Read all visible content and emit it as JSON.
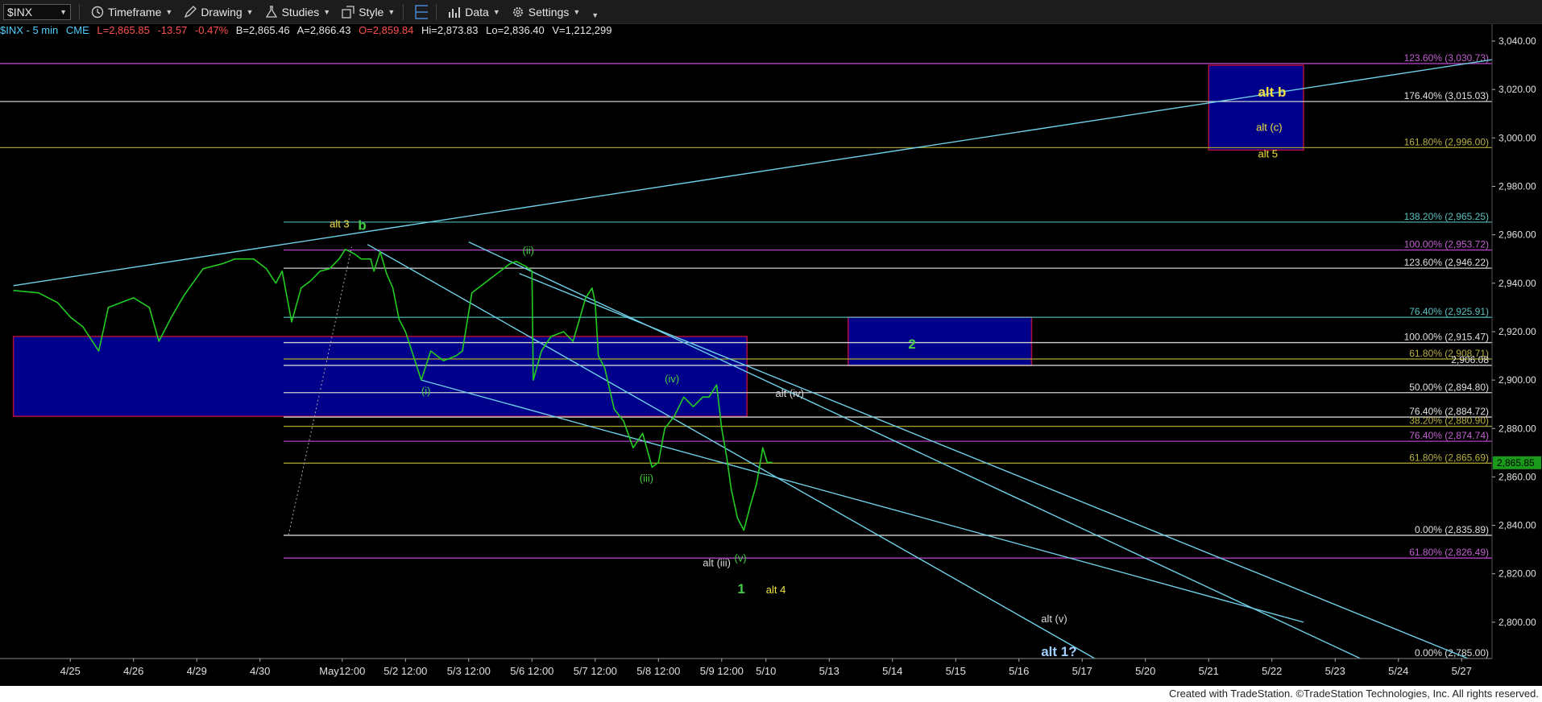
{
  "toolbar": {
    "symbol": "$INX",
    "timeframe": "Timeframe",
    "drawing": "Drawing",
    "studies": "Studies",
    "style": "Style",
    "data": "Data",
    "settings": "Settings"
  },
  "quote": {
    "name": "$INX - 5 min",
    "exchange": "CME",
    "last": "L=2,865.85",
    "change": "-13.57",
    "pct": "-0.47%",
    "bid": "B=2,865.46",
    "ask": "A=2,866.43",
    "open": "O=2,859.84",
    "high": "Hi=2,873.83",
    "low": "Lo=2,836.40",
    "volume": "V=1,212,299"
  },
  "colors": {
    "price": "#22cc22",
    "cyan": "#6fd0e8",
    "box_fill": "#00008b",
    "box_border": "#b0103a",
    "fib_purple": "#b040c0",
    "fib_teal": "#4aa6a6",
    "fib_olive": "#a09a30",
    "fib_white": "#cfcfcf"
  },
  "chart_data": {
    "type": "line",
    "symbol": "$INX",
    "interval": "5 min",
    "ylim": [
      2785,
      3045
    ],
    "yticks": [
      "3,040.00",
      "3,020.00",
      "3,000.00",
      "2,980.00",
      "2,960.00",
      "2,940.00",
      "2,920.00",
      "2,900.00",
      "2,880.00",
      "2,860.00",
      "2,840.00",
      "2,820.00",
      "2,800.00"
    ],
    "ytick_values": [
      3040,
      3020,
      3000,
      2980,
      2960,
      2940,
      2920,
      2900,
      2880,
      2860,
      2840,
      2820,
      2800
    ],
    "xticks": [
      "4/25",
      "4/26",
      "4/29",
      "4/30",
      "May12:00",
      "5/2 12:00",
      "5/3 12:00",
      "5/6 12:00",
      "5/7 12:00",
      "5/8 12:00",
      "5/9 12:00",
      "5/10",
      "5/13",
      "5/14",
      "5/15",
      "5/16",
      "5/17",
      "5/20",
      "5/21",
      "5/22",
      "5/23",
      "5/24",
      "5/27"
    ],
    "xtick_index": [
      0.5,
      1.5,
      2.5,
      3.5,
      4.8,
      5.8,
      6.8,
      7.8,
      8.8,
      9.8,
      10.8,
      11.5,
      12.5,
      13.5,
      14.5,
      15.5,
      16.5,
      17.5,
      18.5,
      19.5,
      20.5,
      21.5,
      22.5
    ],
    "last_price": "2,865.85",
    "last_value": 2865.85,
    "price_path": [
      [
        -0.4,
        2937
      ],
      [
        0,
        2936
      ],
      [
        0.3,
        2932
      ],
      [
        0.5,
        2926
      ],
      [
        0.7,
        2922
      ],
      [
        0.95,
        2912
      ],
      [
        1.1,
        2930
      ],
      [
        1.3,
        2932
      ],
      [
        1.5,
        2934
      ],
      [
        1.75,
        2930
      ],
      [
        1.9,
        2916
      ],
      [
        2.1,
        2926
      ],
      [
        2.3,
        2935
      ],
      [
        2.6,
        2946
      ],
      [
        2.9,
        2948
      ],
      [
        3.1,
        2950
      ],
      [
        3.4,
        2950
      ],
      [
        3.6,
        2946
      ],
      [
        3.75,
        2940
      ],
      [
        3.85,
        2945
      ],
      [
        4.0,
        2924
      ],
      [
        4.15,
        2938
      ],
      [
        4.3,
        2941
      ],
      [
        4.45,
        2945
      ],
      [
        4.6,
        2946
      ],
      [
        4.75,
        2950
      ],
      [
        4.85,
        2954
      ],
      [
        5.0,
        2952
      ],
      [
        5.1,
        2950
      ],
      [
        5.25,
        2950
      ],
      [
        5.3,
        2945
      ],
      [
        5.4,
        2953
      ],
      [
        5.5,
        2944
      ],
      [
        5.6,
        2938
      ],
      [
        5.7,
        2925
      ],
      [
        5.8,
        2920
      ],
      [
        5.95,
        2908
      ],
      [
        6.05,
        2900
      ],
      [
        6.2,
        2912
      ],
      [
        6.4,
        2908
      ],
      [
        6.6,
        2910
      ],
      [
        6.7,
        2912
      ],
      [
        6.85,
        2936
      ],
      [
        7.05,
        2940
      ],
      [
        7.3,
        2945
      ],
      [
        7.45,
        2948
      ],
      [
        7.55,
        2949
      ],
      [
        7.7,
        2947
      ],
      [
        7.8,
        2945
      ],
      [
        7.82,
        2900
      ],
      [
        7.95,
        2912
      ],
      [
        8.1,
        2918
      ],
      [
        8.3,
        2920
      ],
      [
        8.45,
        2916
      ],
      [
        8.55,
        2925
      ],
      [
        8.65,
        2934
      ],
      [
        8.75,
        2938
      ],
      [
        8.8,
        2932
      ],
      [
        8.85,
        2910
      ],
      [
        8.95,
        2905
      ],
      [
        9.1,
        2888
      ],
      [
        9.25,
        2883
      ],
      [
        9.4,
        2872
      ],
      [
        9.55,
        2878
      ],
      [
        9.7,
        2864
      ],
      [
        9.8,
        2866
      ],
      [
        9.9,
        2880
      ],
      [
        10.05,
        2885
      ],
      [
        10.2,
        2893
      ],
      [
        10.35,
        2889
      ],
      [
        10.5,
        2893
      ],
      [
        10.6,
        2893
      ],
      [
        10.72,
        2898
      ],
      [
        10.8,
        2880
      ],
      [
        10.88,
        2868
      ],
      [
        10.95,
        2855
      ],
      [
        11.05,
        2843
      ],
      [
        11.15,
        2838
      ],
      [
        11.25,
        2848
      ],
      [
        11.35,
        2857
      ],
      [
        11.45,
        2872
      ],
      [
        11.52,
        2866
      ],
      [
        11.6,
        2866
      ]
    ],
    "fib_levels": [
      {
        "label": "123.60% (3,030.73)",
        "value": 3030.73,
        "color": "purple"
      },
      {
        "label": "176.40% (3,015.03)",
        "value": 3015.03,
        "color": "white"
      },
      {
        "label": "161.80% (2,996.00)",
        "value": 2996.0,
        "color": "olive"
      },
      {
        "label": "138.20% (2,965.25)",
        "value": 2965.25,
        "color": "teal"
      },
      {
        "label": "100.00% (2,953.72)",
        "value": 2953.72,
        "color": "purple"
      },
      {
        "label": "123.60% (2,946.22)",
        "value": 2946.22,
        "color": "white"
      },
      {
        "label": "76.40% (2,925.91)",
        "value": 2925.91,
        "color": "teal"
      },
      {
        "label": "100.00% (2,915.47)",
        "value": 2915.47,
        "color": "white"
      },
      {
        "label": "61.80% (2,908.71)",
        "value": 2908.71,
        "color": "olive"
      },
      {
        "label": "2,906.08",
        "value": 2906.08,
        "color": "white"
      },
      {
        "label": "50.00% (2,894.80)",
        "value": 2894.8,
        "color": "white"
      },
      {
        "label": "76.40% (2,884.72)",
        "value": 2884.72,
        "color": "white"
      },
      {
        "label": "38.20% (2,880.90)",
        "value": 2880.9,
        "color": "olive"
      },
      {
        "label": "76.40% (2,874.74)",
        "value": 2874.74,
        "color": "purple"
      },
      {
        "label": "61.80% (2,865.69)",
        "value": 2865.69,
        "color": "olive"
      },
      {
        "label": "0.00% (2,835.89)",
        "value": 2835.89,
        "color": "white"
      },
      {
        "label": "61.80% (2,826.49)",
        "value": 2826.49,
        "color": "purple"
      },
      {
        "label": "0.00% (2,785.00)",
        "value": 2785.0,
        "color": "white"
      }
    ],
    "boxes": [
      {
        "name": "support-box",
        "x0": -0.4,
        "x1": 11.2,
        "y0": 2885,
        "y1": 2918,
        "label": ""
      },
      {
        "name": "wave-2-box",
        "x0": 12.8,
        "x1": 15.7,
        "y0": 2906,
        "y1": 2926,
        "label": "2"
      },
      {
        "name": "alt-b-box",
        "x0": 18.5,
        "x1": 20.0,
        "y0": 2995,
        "y1": 3030,
        "label": ""
      }
    ],
    "trendlines": [
      {
        "from": [
          -0.4,
          2939
        ],
        "to": [
          23.4,
          3034
        ]
      },
      {
        "from": [
          5.2,
          2956
        ],
        "to": [
          16.7,
          2785
        ]
      },
      {
        "from": [
          6.8,
          2957
        ],
        "to": [
          20.9,
          2785
        ]
      },
      {
        "from": [
          7.6,
          2944
        ],
        "to": [
          22.6,
          2785
        ]
      },
      {
        "from": [
          6.05,
          2900
        ],
        "to": [
          20.0,
          2800
        ]
      }
    ],
    "annotations": [
      {
        "text": "alt 3",
        "x": 4.6,
        "y": 2963,
        "color": "yellow"
      },
      {
        "text": "b",
        "x": 5.05,
        "y": 2962,
        "color": "green"
      },
      {
        "text": "(ii)",
        "x": 7.65,
        "y": 2952,
        "color": "green"
      },
      {
        "text": "(i)",
        "x": 6.05,
        "y": 2894,
        "color": "green"
      },
      {
        "text": "(iv)",
        "x": 9.9,
        "y": 2899,
        "color": "green"
      },
      {
        "text": "alt (iv)",
        "x": 11.65,
        "y": 2893,
        "color": "white"
      },
      {
        "text": "(iii)",
        "x": 9.5,
        "y": 2858,
        "color": "green"
      },
      {
        "text": "alt (iii)",
        "x": 10.5,
        "y": 2823,
        "color": "white"
      },
      {
        "text": "(v)",
        "x": 11.0,
        "y": 2825,
        "color": "green"
      },
      {
        "text": "1",
        "x": 11.05,
        "y": 2812,
        "color": "green"
      },
      {
        "text": "alt 4",
        "x": 11.5,
        "y": 2812,
        "color": "yellow"
      },
      {
        "text": "2",
        "x": 13.75,
        "y": 2913,
        "color": "green"
      },
      {
        "text": "alt b",
        "x": 19.28,
        "y": 3017,
        "color": "yellow"
      },
      {
        "text": "alt (c)",
        "x": 19.25,
        "y": 3003,
        "color": "yellow"
      },
      {
        "text": "alt 5",
        "x": 19.28,
        "y": 2992,
        "color": "yellow"
      },
      {
        "text": "alt (v)",
        "x": 15.85,
        "y": 2800,
        "color": "white"
      },
      {
        "text": "alt 1?",
        "x": 15.85,
        "y": 2786,
        "color": "cyan"
      }
    ]
  },
  "footer": {
    "credit": "Created with TradeStation. ©TradeStation Technologies, Inc. All rights reserved."
  }
}
